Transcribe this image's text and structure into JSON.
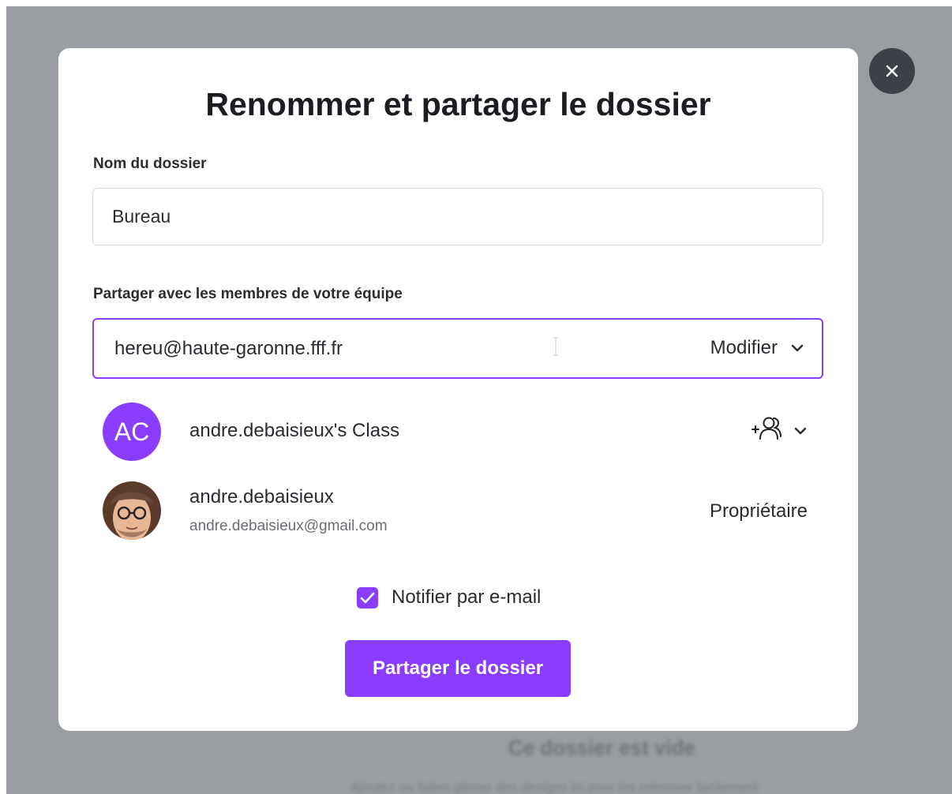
{
  "background": {
    "title": "Ce dossier est vide",
    "subtitle": "Ajoutez ou faites glisser des designs ici pour les retrouver facilement"
  },
  "dialog": {
    "title": "Renommer et partager le dossier",
    "close_icon": "close-icon",
    "folder_name": {
      "label": "Nom du dossier",
      "value": "Bureau"
    },
    "share": {
      "label": "Partager avec les membres de votre équipe",
      "input_value": "hereu@haute-garonne.fff.fr",
      "permission": "Modifier"
    },
    "members": [
      {
        "initials": "AC",
        "name": "andre.debaisieux's Class",
        "role_icon": "add-group-icon"
      },
      {
        "name": "andre.debaisieux",
        "email": "andre.debaisieux@gmail.com",
        "role": "Propriétaire"
      }
    ],
    "notify": {
      "label": "Notifier par e-mail",
      "checked": true
    },
    "submit_label": "Partager le dossier"
  },
  "colors": {
    "accent": "#8b3dff",
    "backdrop": "#9a9ea3",
    "close_button": "#3d4046",
    "text": "#2a2b30"
  }
}
